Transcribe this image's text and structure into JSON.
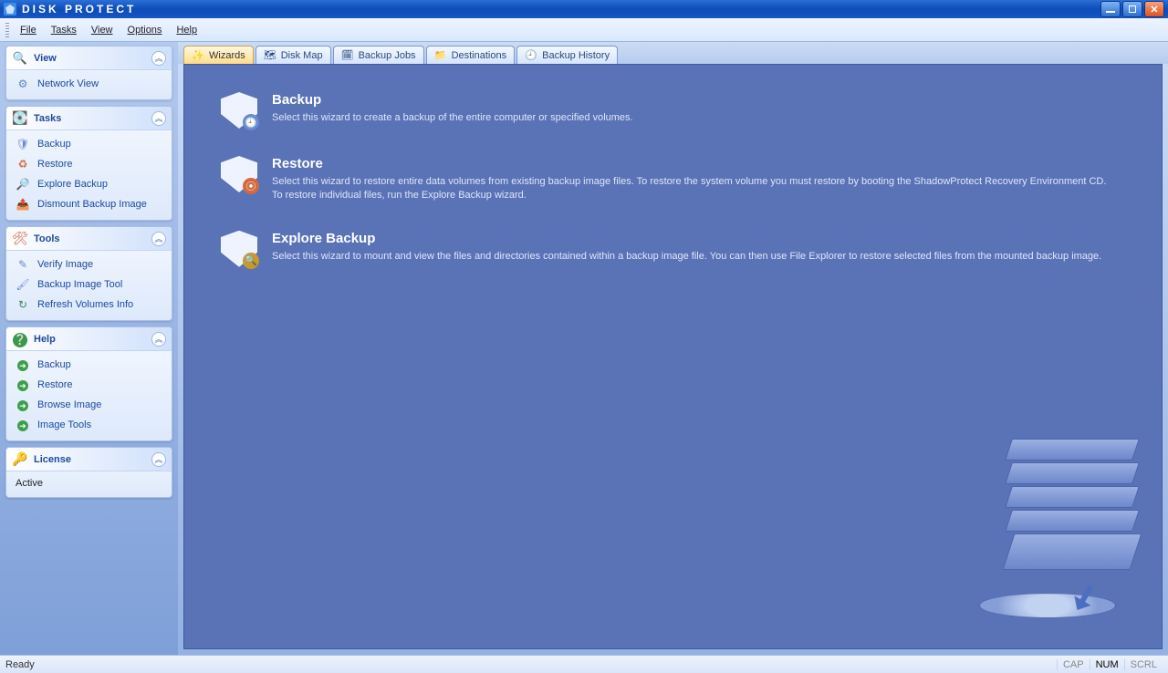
{
  "app": {
    "title": "DISK PROTECT"
  },
  "menu": {
    "file": "File",
    "tasks": "Tasks",
    "view": "View",
    "options": "Options",
    "help": "Help"
  },
  "sidebar": {
    "view": {
      "title": "View",
      "items": [
        "Network View"
      ]
    },
    "tasks": {
      "title": "Tasks",
      "items": [
        "Backup",
        "Restore",
        "Explore Backup",
        "Dismount Backup Image"
      ]
    },
    "tools": {
      "title": "Tools",
      "items": [
        "Verify Image",
        "Backup Image Tool",
        "Refresh Volumes Info"
      ]
    },
    "help": {
      "title": "Help",
      "items": [
        "Backup",
        "Restore",
        "Browse Image",
        "Image Tools"
      ]
    },
    "license": {
      "title": "License",
      "status": "Active"
    }
  },
  "tabs": {
    "wizards": "Wizards",
    "diskmap": "Disk Map",
    "backupjobs": "Backup Jobs",
    "destinations": "Destinations",
    "history": "Backup History"
  },
  "wizards": {
    "backup": {
      "title": "Backup",
      "desc": "Select this wizard to create a backup of the entire computer or specified volumes."
    },
    "restore": {
      "title": "Restore",
      "desc": "Select this wizard to restore entire data volumes from existing backup image files.  To restore the system volume you must restore by booting the ShadowProtect Recovery Environment CD.  To restore individual files, run the Explore Backup wizard."
    },
    "explore": {
      "title": "Explore Backup",
      "desc": "Select this wizard to mount and view the files and directories contained within a backup image file.  You can then use File Explorer to restore selected files from the mounted backup image."
    }
  },
  "status": {
    "ready": "Ready",
    "cap": "CAP",
    "num": "NUM",
    "scrl": "SCRL"
  }
}
